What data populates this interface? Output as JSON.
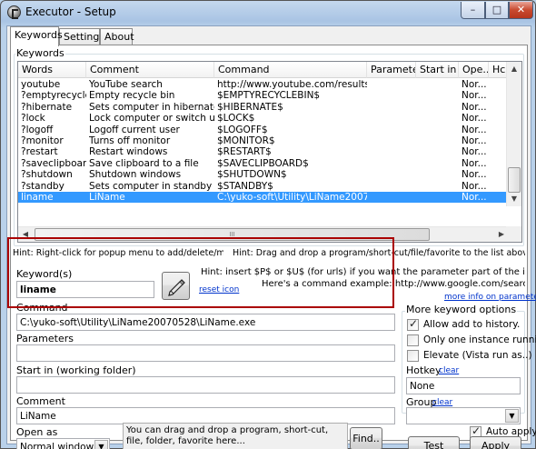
{
  "window": {
    "title": "Executor - Setup"
  },
  "tabs": [
    {
      "label": "Keywords",
      "active": true
    },
    {
      "label": "Settings",
      "active": false
    },
    {
      "label": "About",
      "active": false
    }
  ],
  "keywords_group": {
    "label": "Keywords",
    "columns": [
      "Words",
      "Comment",
      "Command",
      "Parameter",
      "Start in",
      "Ope...",
      "Hc"
    ],
    "rows": [
      [
        "youtube",
        "YouTube search",
        "http://www.youtube.com/results?se...",
        "",
        "",
        "Nor..."
      ],
      [
        "?emptyrecycle...",
        "Empty recycle bin",
        "$EMPTYRECYCLEBIN$",
        "",
        "",
        "Nor..."
      ],
      [
        "?hibernate",
        "Sets computer in hibernate m...",
        "$HIBERNATE$",
        "",
        "",
        "Nor..."
      ],
      [
        "?lock",
        "Lock computer or switch user",
        "$LOCK$",
        "",
        "",
        "Nor..."
      ],
      [
        "?logoff",
        "Logoff current user",
        "$LOGOFF$",
        "",
        "",
        "Nor..."
      ],
      [
        "?monitor",
        "Turns off monitor",
        "$MONITOR$",
        "",
        "",
        "Nor..."
      ],
      [
        "?restart",
        "Restart windows",
        "$RESTART$",
        "",
        "",
        "Nor..."
      ],
      [
        "?saveclipboard",
        "Save clipboard to a file",
        "$SAVECLIPBOARD$",
        "",
        "",
        "Nor..."
      ],
      [
        "?shutdown",
        "Shutdown windows",
        "$SHUTDOWN$",
        "",
        "",
        "Nor..."
      ],
      [
        "?standby",
        "Sets computer in standby mode",
        "$STANDBY$",
        "",
        "",
        "Nor..."
      ],
      [
        "liname",
        "LiName",
        "C:\\yuko-soft\\Utility\\LiName2007052...",
        "",
        "",
        "Nor..."
      ]
    ],
    "selected_row_index": 10,
    "hscroll_glyph": "III"
  },
  "hints": {
    "left": "Hint: Right-click for popup menu to add/delete/move",
    "right": "Hint: Drag and drop a program/short-cut/file/favorite to the list above (to add)",
    "param_line1": "Hint: insert $P$ or $U$ (for urls) if you want the parameter part of the input to be applied.",
    "param_line2": "Here's a command example: http://www.google.com/search?q=$U$",
    "more_info": "more info on parameters",
    "drop": "You can drag and drop a program, short-cut, file, folder, favorite here..."
  },
  "form": {
    "keyword_label": "Keyword(s)",
    "keyword_value": "liname",
    "reset_icon": "reset icon",
    "command_label": "Command",
    "command_value": "C:\\yuko-soft\\Utility\\LiName20070528\\LiName.exe",
    "parameters_label": "Parameters",
    "parameters_value": "",
    "startin_label": "Start in (working folder)",
    "startin_value": "",
    "comment_label": "Comment",
    "comment_value": "LiName",
    "openas_label": "Open as",
    "openas_value": "Normal window",
    "find_button": "Find.."
  },
  "options": {
    "group_label": "More keyword options",
    "allow_history": {
      "label": "Allow add to history.",
      "checked": true
    },
    "one_instance": {
      "label": "Only one instance running.",
      "checked": false
    },
    "elevate": {
      "label": "Elevate (Vista run as..)",
      "checked": false
    },
    "hotkey_label": "Hotkey",
    "hotkey_clear": "clear",
    "hotkey_value": "None",
    "group_field_label": "Group",
    "group_clear": "clear",
    "group_value": ""
  },
  "bottom": {
    "auto_apply": {
      "label": "Auto apply",
      "checked": true
    },
    "test_button": "Test",
    "apply_button": "Apply"
  },
  "caption_buttons": {
    "minimize": "–",
    "maximize": "□",
    "close": "✕"
  },
  "icons": {
    "edit": "pencil-icon",
    "scroll_up": "▲",
    "scroll_down": "▼",
    "scroll_left": "◀",
    "scroll_right": "▶"
  },
  "colors": {
    "selection": "#3399ff",
    "link": "#0033cc",
    "highlight_box": "#aa0000"
  }
}
